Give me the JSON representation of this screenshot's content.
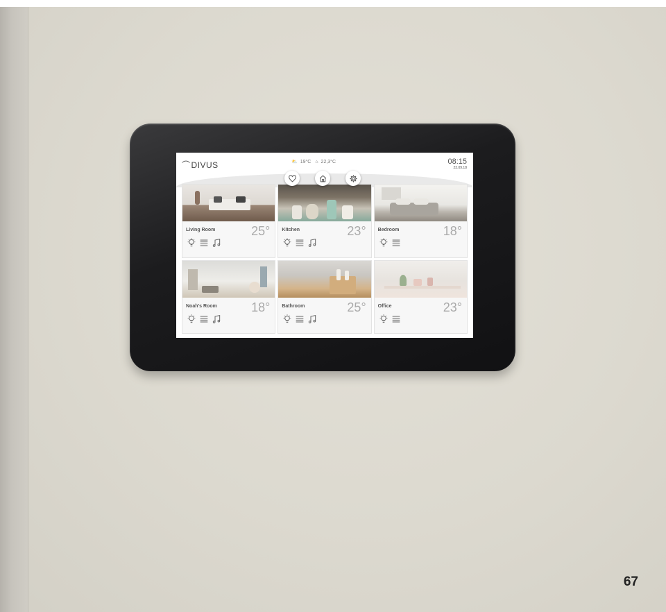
{
  "header": {
    "logo": "DIVUS",
    "weather": {
      "outdoor": "19°C",
      "indoor": "22,3°C"
    },
    "time": "08:15",
    "date": "23.09.18"
  },
  "nav": [
    {
      "name": "favorites-button",
      "icon": "heart-icon"
    },
    {
      "name": "home-button",
      "icon": "home-icon"
    },
    {
      "name": "settings-button",
      "icon": "gear-icon"
    }
  ],
  "rooms": [
    {
      "name": "Living Room",
      "temp": "25°",
      "icons": [
        "light-bulb-icon",
        "blinds-icon",
        "music-note-icon"
      ]
    },
    {
      "name": "Kitchen",
      "temp": "23°",
      "icons": [
        "light-bulb-icon",
        "blinds-icon",
        "music-note-icon"
      ]
    },
    {
      "name": "Bedroom",
      "temp": "18°",
      "icons": [
        "light-bulb-icon",
        "blinds-icon"
      ]
    },
    {
      "name": "Noah's Room",
      "temp": "18°",
      "icons": [
        "light-bulb-icon",
        "blinds-icon",
        "music-note-icon"
      ]
    },
    {
      "name": "Bathroom",
      "temp": "25°",
      "icons": [
        "light-bulb-icon",
        "blinds-icon",
        "music-note-icon"
      ]
    },
    {
      "name": "Office",
      "temp": "23°",
      "icons": [
        "light-bulb-icon",
        "blinds-icon"
      ]
    }
  ],
  "page_number": "67"
}
